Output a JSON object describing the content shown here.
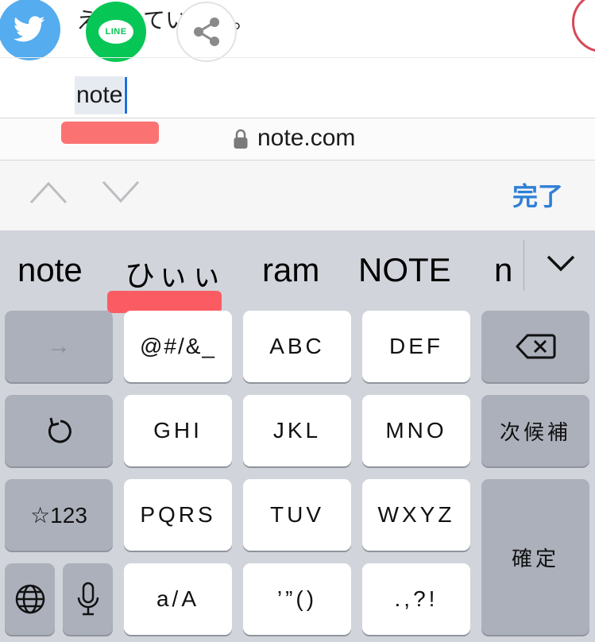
{
  "content": {
    "body_text": "え　　てい　　。",
    "input_value": "note"
  },
  "share_buttons": {
    "line_label": "LINE"
  },
  "url_bar": {
    "url": "note.com",
    "lock_icon": "lock-icon"
  },
  "accessory": {
    "prev_icon": "chevron-up-icon",
    "next_icon": "chevron-down-icon",
    "done_label": "完了"
  },
  "candidates": [
    "note",
    "ひぃぃ",
    "ram",
    "NOTE",
    "n"
  ],
  "keys": {
    "arrow_label": "→",
    "symbols_label": "@#/&_",
    "abc_label": "ABC",
    "def_label": "DEF",
    "undo_icon": "undo-icon",
    "ghi_label": "GHI",
    "jkl_label": "JKL",
    "mno_label": "MNO",
    "next_candidate_label": "次候補",
    "numbers_label": "☆123",
    "pqrs_label": "PQRS",
    "tuv_label": "TUV",
    "wxyz_label": "WXYZ",
    "confirm_label": "確定",
    "globe_icon": "globe-icon",
    "mic_icon": "microphone-icon",
    "case_label": "a/A",
    "quotes_label": "’”()",
    "punctuation_label": ".,?!",
    "delete_icon": "backspace-icon"
  },
  "colors": {
    "twitter": "#55acee",
    "line": "#06c755",
    "done_text": "#2f7fd6",
    "annotation_red": "#fb6a6a",
    "keyboard_bg": "#d1d4da"
  }
}
